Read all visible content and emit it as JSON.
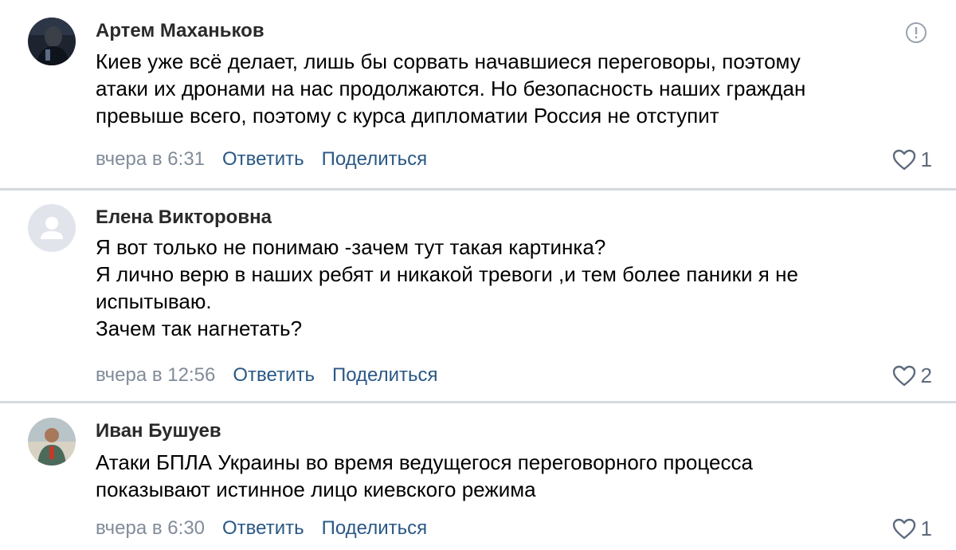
{
  "comments": [
    {
      "author": "Артем Маханьков",
      "text": [
        "Киев уже всё делает, лишь бы сорвать начавшиеся переговоры, поэтому",
        "атаки их дронами на нас продолжаются. Но безопасность наших граждан",
        "превыше всего, поэтому с курса дипломатии Россия не отступит"
      ],
      "time": "вчера в 6:31",
      "reply_label": "Ответить",
      "share_label": "Поделиться",
      "likes": "1"
    },
    {
      "author": "Елена Викторовна",
      "text": [
        "Я вот только не понимаю -зачем тут такая картинка?",
        "Я лично верю в наших ребят и никакой тревоги ,и тем более паники я не",
        "испытываю.",
        "Зачем так нагнетать?"
      ],
      "time": "вчера в 12:56",
      "reply_label": "Ответить",
      "share_label": "Поделиться",
      "likes": "2"
    },
    {
      "author": "Иван Бушуев",
      "text": [
        "Атаки БПЛА Украины во время ведущегося переговорного процесса",
        "показывают истинное лицо киевского режима"
      ],
      "time": "вчера в 6:30",
      "reply_label": "Ответить",
      "share_label": "Поделиться",
      "likes": "1"
    }
  ],
  "colors": {
    "link": "#2a5885",
    "muted": "#818c99",
    "divider": "#d3d9de"
  },
  "icons": [
    "report-icon",
    "heart-icon",
    "default-avatar-icon"
  ]
}
